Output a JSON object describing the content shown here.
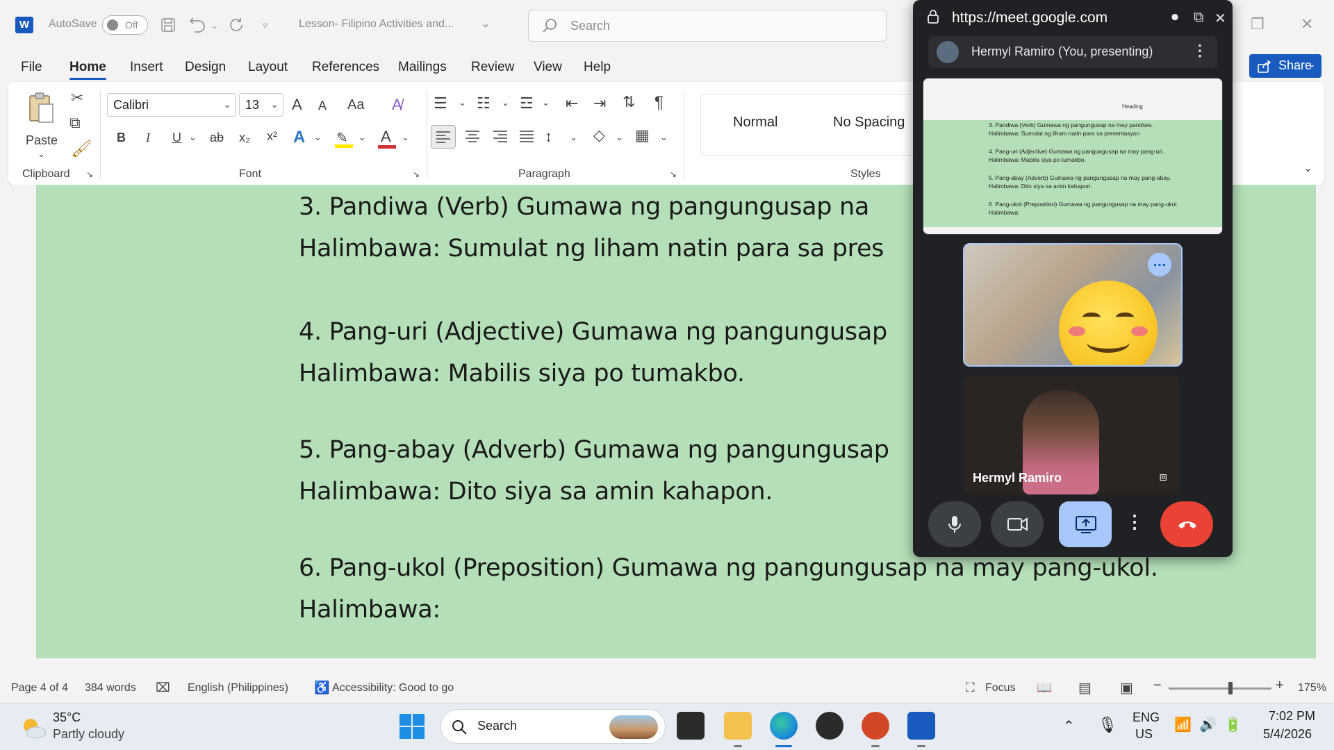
{
  "titlebar": {
    "app_icon": "W",
    "autosave_label": "AutoSave",
    "autosave_state": "Off",
    "doc_title": "Lesson- Filipino Activities and...",
    "search_placeholder": "Search"
  },
  "menu": {
    "tabs": [
      "File",
      "Home",
      "Insert",
      "Design",
      "Layout",
      "References",
      "Mailings",
      "Review",
      "View",
      "Help"
    ],
    "active": "Home",
    "share_label": "Share"
  },
  "ribbon": {
    "paste_label": "Paste",
    "clipboard_label": "Clipboard",
    "font_name": "Calibri",
    "font_size": "13",
    "font_label": "Font",
    "paragraph_label": "Paragraph",
    "styles_label": "Styles",
    "styles": [
      "Normal",
      "No Spacing"
    ],
    "bold": "B",
    "italic": "I",
    "underline": "U",
    "strike": "ab",
    "grow": "A",
    "shrink": "A",
    "case": "Aa"
  },
  "document": {
    "lines": [
      " 3. Pandiwa (Verb) Gumawa ng pangungusap na",
      "Halimbawa: Sumulat ng liham natin para sa pres",
      "4. Pang-uri (Adjective) Gumawa ng pangungusap",
      "Halimbawa: Mabilis siya po tumakbo.",
      "5. Pang-abay (Adverb) Gumawa ng pangungusap",
      " Halimbawa:  Dito siya sa amin kahapon.",
      "6. Pang-ukol (Preposition) Gumawa ng pangungusap na may pang-ukol.",
      "Halimbawa:"
    ],
    "background_color": "#b5dfb8"
  },
  "statusbar": {
    "page": "Page 4 of 4",
    "words": "384 words",
    "language": "English (Philippines)",
    "accessibility": "Accessibility: Good to go",
    "focus": "Focus",
    "zoom": "175%"
  },
  "meet": {
    "url": "https://meet.google.com",
    "presenter": "Hermyl Ramiro (You, presenting)",
    "thumb_lines": [
      "3. Pandiwa (Verb) Gumawa ng pangungusap na may pandiwa.",
      "Halimbawa: Sumulat ng liham natin para sa presentasyon",
      "4. Pang-uri (Adjective) Gumawa ng pangungusap na may pang-uri.",
      "Halimbawa: Mabilis siya po tumakbo.",
      "5. Pang-abay (Adverb) Gumawa ng pangungusap na may pang-abay.",
      "Halimbawa: Dito siya sa amin kahapon.",
      "6. Pang-ukol (Preposition) Gumawa ng pangungusap na may pang-ukol.",
      "Halimbawa:"
    ],
    "thumb_heading": "Heading",
    "participant_name": "Hermyl Ramiro",
    "end_call_color": "#ea4335",
    "present_color": "#a8c7fa"
  },
  "taskbar": {
    "temperature": "35°C",
    "weather": "Partly cloudy",
    "search_placeholder": "Search",
    "lang_top": "ENG",
    "lang_bottom": "US",
    "time": "7:02 PM",
    "date": "5/4/2026"
  }
}
